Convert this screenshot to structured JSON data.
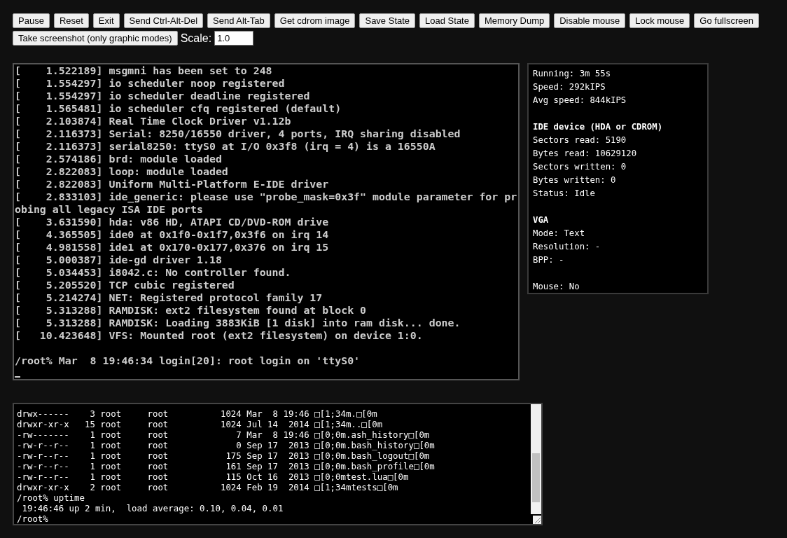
{
  "toolbar": {
    "buttons": [
      "Pause",
      "Reset",
      "Exit",
      "Send Ctrl-Alt-Del",
      "Send Alt-Tab",
      "Get cdrom image",
      "Save State",
      "Load State",
      "Memory Dump",
      "Disable mouse",
      "Lock mouse",
      "Go fullscreen",
      "Take screenshot (only graphic modes)"
    ],
    "scale_label": "Scale:",
    "scale_value": "1.0"
  },
  "screen": {
    "lines": [
      {
        "kind": "text",
        "text": "[    1.522189] msgmni has been set to 248"
      },
      {
        "kind": "text",
        "text": "[    1.554297] io scheduler noop registered"
      },
      {
        "kind": "text",
        "text": "[    1.554297] io scheduler deadline registered"
      },
      {
        "kind": "text",
        "text": "[    1.565481] io scheduler cfq registered (default)"
      },
      {
        "kind": "text",
        "text": "[    2.103874] Real Time Clock Driver v1.12b"
      },
      {
        "kind": "text",
        "text": "[    2.116373] Serial: 8250/16550 driver, 4 ports, IRQ sharing disabled"
      },
      {
        "kind": "text",
        "text": "[    2.116373] serial8250: ttyS0 at I/O 0x3f8 (irq = 4) is a 16550A"
      },
      {
        "kind": "text",
        "text": "[    2.574186] brd: module loaded"
      },
      {
        "kind": "text",
        "text": "[    2.822083] loop: module loaded"
      },
      {
        "kind": "text",
        "text": "[    2.822083] Uniform Multi-Platform E-IDE driver"
      },
      {
        "kind": "text",
        "text": "[    2.833103] ide_generic: please use \"probe_mask=0x3f\" module parameter for pr"
      },
      {
        "kind": "text",
        "text": "obing all legacy ISA IDE ports"
      },
      {
        "kind": "text",
        "text": "[    3.631590] hda: v86 HD, ATAPI CD/DVD-ROM drive"
      },
      {
        "kind": "text",
        "text": "[    4.365505] ide0 at 0x1f0-0x1f7,0x3f6 on irq 14"
      },
      {
        "kind": "text",
        "text": "[    4.981558] ide1 at 0x170-0x177,0x376 on irq 15"
      },
      {
        "kind": "text",
        "text": "[    5.000387] ide-gd driver 1.18"
      },
      {
        "kind": "text",
        "text": "[    5.034453] i8042.c: No controller found."
      },
      {
        "kind": "text",
        "text": "[    5.205520] TCP cubic registered"
      },
      {
        "kind": "text",
        "text": "[    5.214274] NET: Registered protocol family 17"
      },
      {
        "kind": "text",
        "text": "[    5.313288] RAMDISK: ext2 filesystem found at block 0"
      },
      {
        "kind": "text",
        "text": "[    5.313288] RAMDISK: Loading 3883KiB [1 disk] into ram disk... done."
      },
      {
        "kind": "text",
        "text": "[   10.423648] VFS: Mounted root (ext2 filesystem) on device 1:0."
      },
      {
        "kind": "blank"
      },
      {
        "kind": "text",
        "text": "/root% Mar  8 19:46:34 login[20]: root login on 'ttyS0'"
      },
      {
        "kind": "cursor"
      }
    ]
  },
  "info": {
    "sections": [
      {
        "lines": [
          "Running: 3m 55s",
          "Speed: 292kIPS",
          "Avg speed: 844kIPS"
        ]
      },
      {
        "heading": "IDE device (HDA or CDROM)",
        "lines": [
          "Sectors read: 5190",
          "Bytes read: 10629120",
          "Sectors written: 0",
          "Bytes written: 0",
          "Status: Idle"
        ]
      },
      {
        "heading": "VGA",
        "lines": [
          "Mode: Text",
          "Resolution: -",
          "BPP: -"
        ]
      },
      {
        "lines": [
          "Mouse: No"
        ]
      }
    ]
  },
  "serial_log": {
    "lines": [
      "drwx------    3 root     root          1024 Mar  8 19:46 □[1;34m.□[0m",
      "drwxr-xr-x   15 root     root          1024 Jul 14  2014 □[1;34m..□[0m",
      "-rw-------    1 root     root             7 Mar  8 19:46 □[0;0m.ash_history□[0m",
      "-rw-r--r--    1 root     root             0 Sep 17  2013 □[0;0m.bash_history□[0m",
      "-rw-r--r--    1 root     root           175 Sep 17  2013 □[0;0m.bash_logout□[0m",
      "-rw-r--r--    1 root     root           161 Sep 17  2013 □[0;0m.bash_profile□[0m",
      "-rw-r--r--    1 root     root           115 Oct 16  2013 □[0;0mtest.lua□[0m",
      "drwxr-xr-x    2 root     root          1024 Feb 19  2014 □[1;34mtests□[0m",
      "/root% uptime",
      " 19:46:46 up 2 min,  load average: 0.10, 0.04, 0.01",
      "/root%"
    ]
  }
}
